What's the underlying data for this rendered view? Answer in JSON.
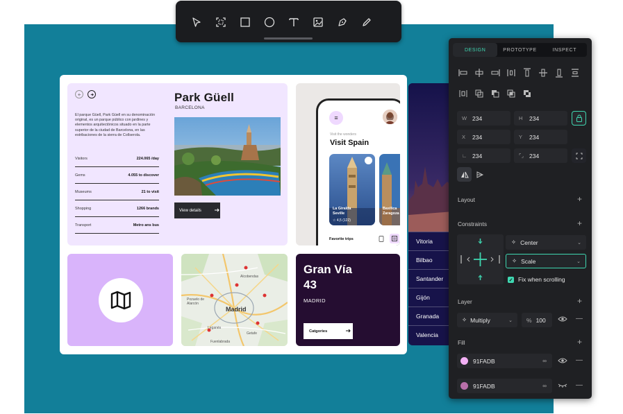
{
  "toolbar": {
    "tools": [
      "pointer-icon",
      "frame-icon",
      "rectangle-icon",
      "ellipse-icon",
      "text-icon",
      "image-icon",
      "pen-icon",
      "pencil-icon"
    ]
  },
  "park": {
    "title": "Park Güell",
    "subtitle": "BARCELONA",
    "description": "El parque Güell, Park Güell en su denominación original, es un parque público con jardines y elementos arquitectónicos situado en la parte superior de la ciudad de Barcelona, en las estribaciones de la sierra de Collserola.",
    "facts": [
      {
        "label": "Visitors",
        "value": "224.065 /day"
      },
      {
        "label": "Gems",
        "value": "4.055 to discover"
      },
      {
        "label": "Museums",
        "value": "21 to visit"
      },
      {
        "label": "Shopping",
        "value": "1266 brands"
      },
      {
        "label": "Transport",
        "value": "Metro ans bus"
      }
    ],
    "button": "View details"
  },
  "app": {
    "menu_glyph": "≡",
    "subheading": "Visit the wonders",
    "heading": "Visit Spain",
    "trips": [
      {
        "name": "La Giralda\nSeville",
        "rating": "4,5 (122)"
      },
      {
        "name": "Basilica\nZaragoza",
        "rating": ""
      }
    ],
    "favorite": "Favorite trips"
  },
  "cities": [
    "Vitoria",
    "Bilbao",
    "Santander",
    "Gijón",
    "Granada",
    "Valencia"
  ],
  "map": {
    "labels": [
      "Alcobendas",
      "Pozuelo de Alarcón",
      "Madrid",
      "Getafe",
      "Fuenlabrada",
      "Leganés"
    ],
    "center": "Madrid"
  },
  "granvia": {
    "title_line1": "Gran Vía",
    "title_line2": "43",
    "subtitle": "MADRID",
    "button": "Catgories"
  },
  "panel": {
    "tabs": [
      "DESIGN",
      "PROTOTYPE",
      "INSPECT"
    ],
    "active_tab": "DESIGN",
    "fields": {
      "w": {
        "label": "W",
        "value": "234"
      },
      "h": {
        "label": "H",
        "value": "234"
      },
      "x": {
        "label": "X",
        "value": "234"
      },
      "y": {
        "label": "Y",
        "value": "234"
      },
      "angle": {
        "label": "∟",
        "value": "234"
      },
      "radius": {
        "label": "⌜⌟",
        "value": "234"
      }
    },
    "sections": {
      "layout": "Layout",
      "constraints": "Constraints",
      "layer": "Layer",
      "fill": "Fill"
    },
    "constraint_h": "Center",
    "constraint_v": "Scale",
    "fix_scrolling": "Fix when scrolling",
    "blend": "Multiply",
    "opacity_label": "%",
    "opacity": "100",
    "fills": [
      {
        "hex": "91FADB",
        "swatch": "#f3b0f5"
      },
      {
        "hex": "91FADB",
        "swatch": "#b86fa9"
      }
    ],
    "accent": "#3fd7b1"
  }
}
